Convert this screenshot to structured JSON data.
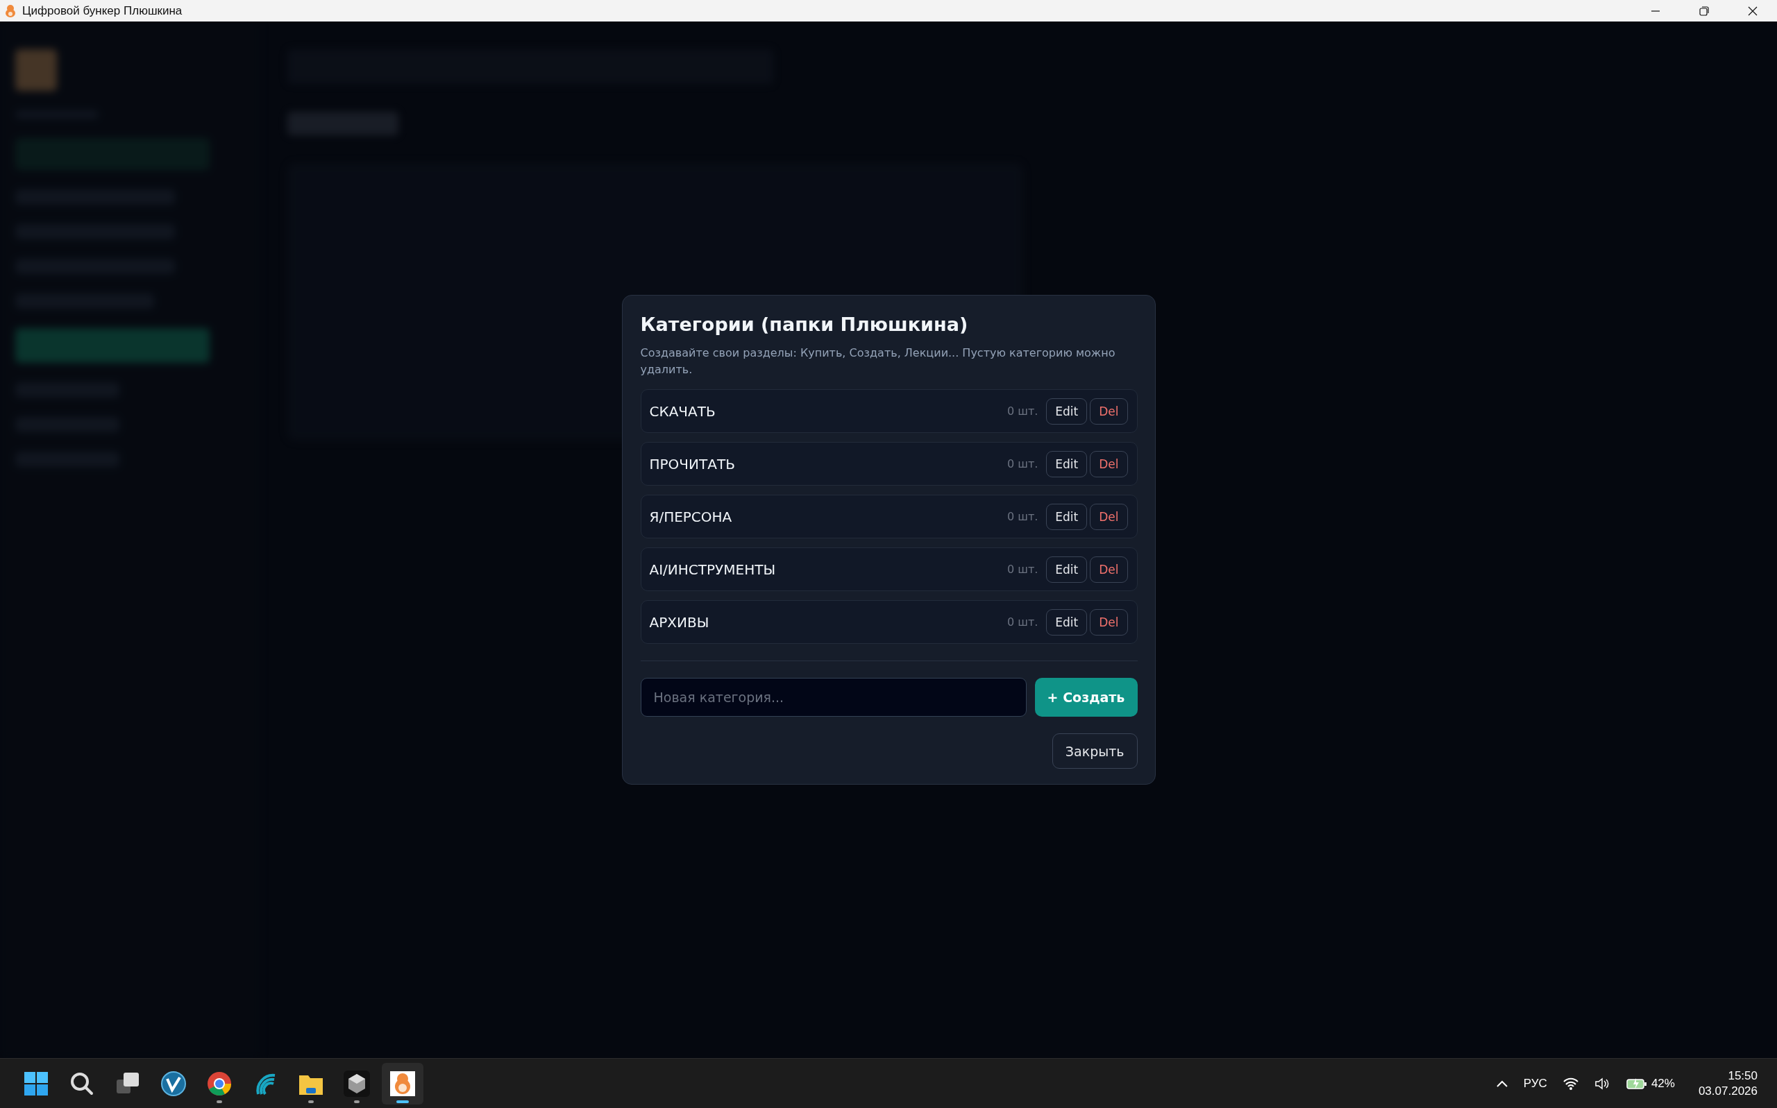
{
  "window": {
    "title": "Цифровой бункер Плюшкина"
  },
  "dialog": {
    "title": "Категории (папки Плюшкина)",
    "description": "Создавайте свои разделы: Купить, Создать, Лекции... Пустую категорию можно удалить.",
    "categories": [
      {
        "name": "СКАЧАТЬ",
        "count": "0 шт.",
        "edit": "Edit",
        "delete": "Del"
      },
      {
        "name": "ПРОЧИТАТЬ",
        "count": "0 шт.",
        "edit": "Edit",
        "delete": "Del"
      },
      {
        "name": "Я/ПЕРСОНА",
        "count": "0 шт.",
        "edit": "Edit",
        "delete": "Del"
      },
      {
        "name": "AI/ИНСТРУМЕНТЫ",
        "count": "0 шт.",
        "edit": "Edit",
        "delete": "Del"
      },
      {
        "name": "АРХИВЫ",
        "count": "0 шт.",
        "edit": "Edit",
        "delete": "Del"
      }
    ],
    "new_category": {
      "placeholder": "Новая категория..."
    },
    "create_button": "+ Создать",
    "close_button": "Закрыть"
  },
  "taskbar": {
    "apps": [
      {
        "kind": "start",
        "running": false,
        "selected": false
      },
      {
        "kind": "search",
        "running": false,
        "selected": false
      },
      {
        "kind": "taskview",
        "running": false,
        "selected": false
      },
      {
        "kind": "vpn",
        "running": false,
        "selected": false
      },
      {
        "kind": "browser",
        "running": true,
        "selected": false
      },
      {
        "kind": "wave",
        "running": false,
        "selected": false
      },
      {
        "kind": "folder",
        "running": true,
        "selected": false
      },
      {
        "kind": "cube",
        "running": true,
        "selected": false
      },
      {
        "kind": "hamster",
        "running": true,
        "selected": true
      }
    ],
    "language": "РУС",
    "battery": "42%",
    "time": "15:50",
    "date": "03.07.2026"
  }
}
